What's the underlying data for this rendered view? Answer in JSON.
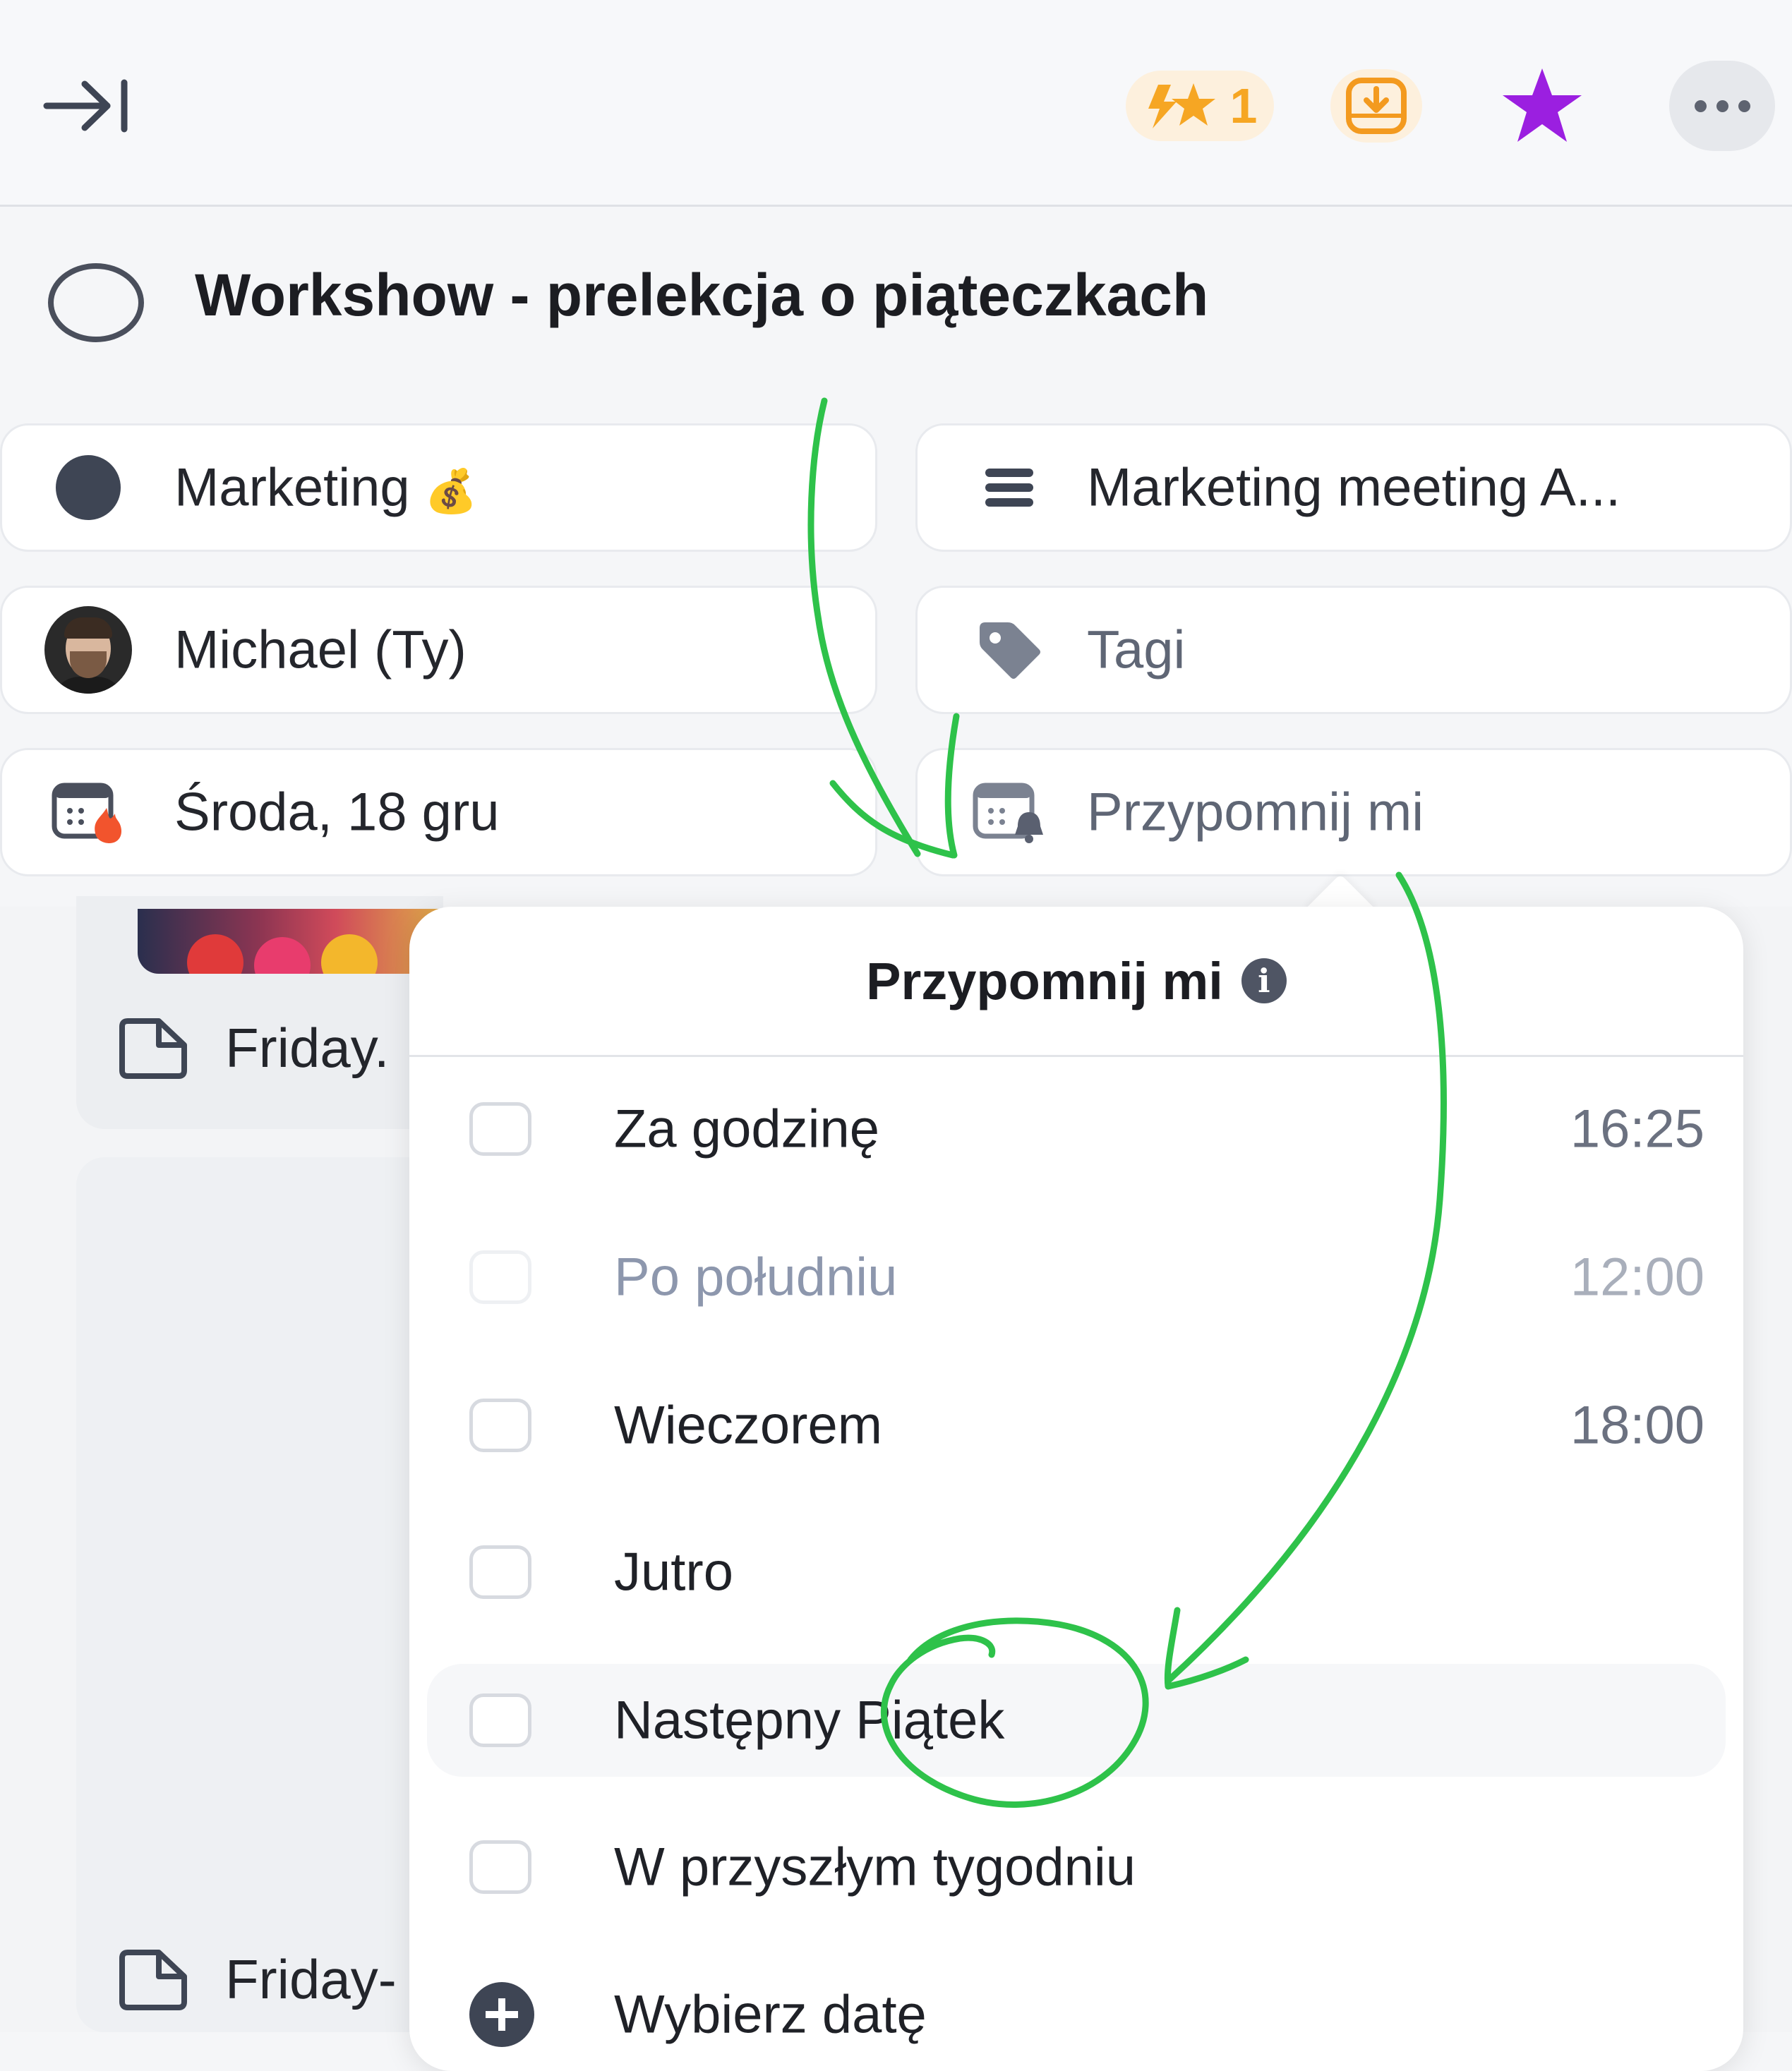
{
  "toolbar": {
    "streak_count": "1",
    "icons": [
      "collapse-panel-icon",
      "streak-lightning-star-icon",
      "download-icon",
      "star-icon",
      "more-icon"
    ],
    "colors": {
      "streak": "#f6a623",
      "star": "#9b1fe0",
      "badge_bg": "#fdf0dd"
    }
  },
  "task": {
    "title": "Workshow - prelekcja o piąteczkach"
  },
  "properties": {
    "project": {
      "label": "Marketing",
      "emoji": "💰"
    },
    "parent": {
      "label": "Marketing meeting A..."
    },
    "owner": {
      "label": "Michael (Ty)"
    },
    "tags": {
      "label": "Tagi"
    },
    "due_date": {
      "label": "Środa, 18 gru"
    },
    "reminder": {
      "label": "Przypomnij mi"
    }
  },
  "background": {
    "row1_label": "Friday.",
    "row2_label": "Friday-"
  },
  "reminder_menu": {
    "title": "Przypomnij mi",
    "info_glyph": "i",
    "options": [
      {
        "label": "Za godzinę",
        "time": "16:25"
      },
      {
        "label": "Po południu",
        "time": "12:00"
      },
      {
        "label": "Wieczorem",
        "time": "18:00"
      },
      {
        "label": "Jutro",
        "time": ""
      },
      {
        "label": "Następny Piątek",
        "time": ""
      },
      {
        "label": "W przyszłym tygodniu",
        "time": ""
      }
    ],
    "pick_date_label": "Wybierz datę"
  },
  "annotation": {
    "color": "#2ec24a"
  }
}
